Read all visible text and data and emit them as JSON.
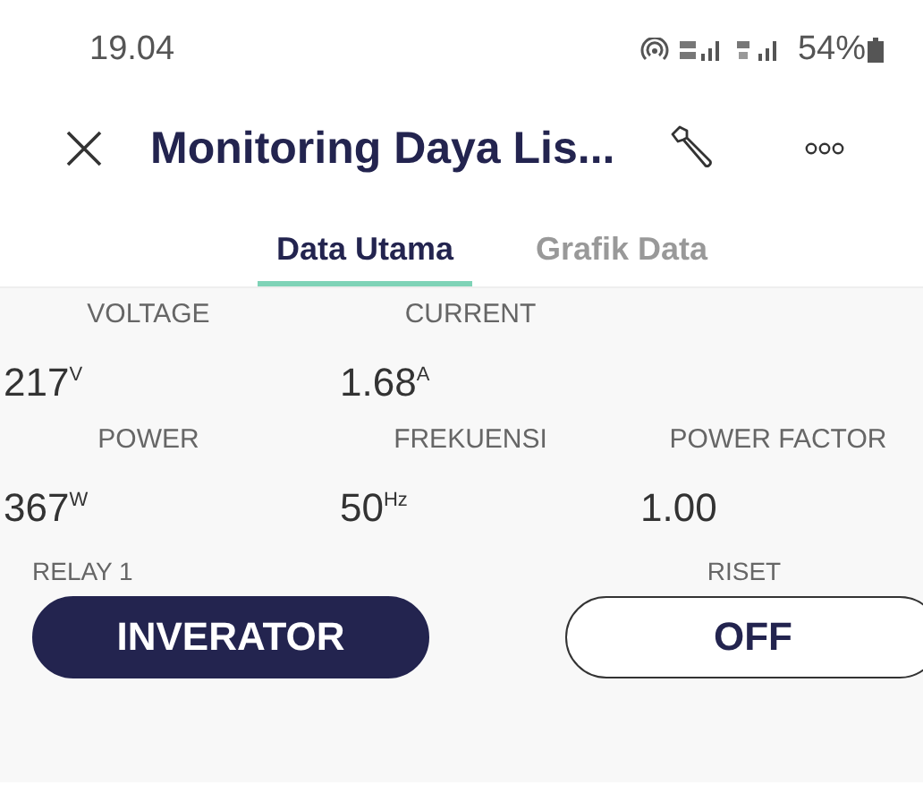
{
  "status_bar": {
    "time": "19.04",
    "battery": "54%"
  },
  "header": {
    "title": "Monitoring Daya Lis..."
  },
  "tabs": [
    {
      "label": "Data Utama",
      "selected": true
    },
    {
      "label": "Grafik Data",
      "selected": false
    }
  ],
  "metric_rows": [
    [
      {
        "label": "VOLTAGE",
        "value": "217",
        "unit": "V"
      },
      {
        "label": "CURRENT",
        "value": "1.68",
        "unit": "A"
      }
    ],
    [
      {
        "label": "POWER",
        "value": "367",
        "unit": "W"
      },
      {
        "label": "FREKUENSI",
        "value": "50",
        "unit": "Hz"
      },
      {
        "label": "POWER FACTOR",
        "value": "1.00"
      }
    ]
  ],
  "controls": [
    {
      "label": "RELAY 1",
      "button": "INVERATOR",
      "on": true
    },
    {
      "label": "RISET",
      "button": "OFF",
      "on": false
    }
  ]
}
